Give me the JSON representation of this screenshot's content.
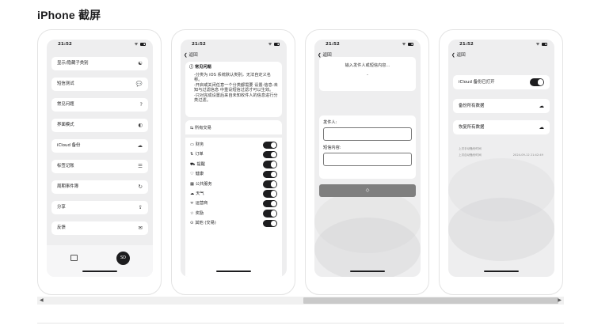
{
  "page_title": "iPhone 截屏",
  "status": {
    "time": "21:52",
    "signal": "•• ᯤ"
  },
  "back_label": "返回",
  "screen1": {
    "items": [
      {
        "label": "显示/隐藏子类别",
        "icon": "☯"
      },
      {
        "label": "短信测试",
        "icon": "💬"
      },
      {
        "label": "常见问题",
        "icon": "?"
      },
      {
        "label": "界面模式",
        "icon": "◐"
      },
      {
        "label": "iCloud 备份",
        "icon": "☁"
      },
      {
        "label": "标签记账",
        "icon": "☰"
      },
      {
        "label": "周期事件簿",
        "icon": "↻"
      },
      {
        "label": "分享",
        "icon": "⇪"
      },
      {
        "label": "反馈",
        "icon": "✉"
      }
    ],
    "tab_badge": "SD"
  },
  "screen2": {
    "faq_title": "常见问题",
    "faq_body": [
      "-分类为 iOS 系统默认类别，无法自定义名称。",
      "-开启或关闭任意一个分类都需要 设置-信息-未知与过滤信息 中重设短信过滤才可以生效。",
      "-只对完成设置后来自未知收件人的信息进行分类过滤。"
    ],
    "all_label": "所有交易",
    "categories": [
      {
        "icon": "▭",
        "label": "财务"
      },
      {
        "icon": "⇅",
        "label": "订单"
      },
      {
        "icon": "⛟",
        "label": "提醒"
      },
      {
        "icon": "♡",
        "label": "健康"
      },
      {
        "icon": "▦",
        "label": "公共服务"
      },
      {
        "icon": "☁",
        "label": "天气"
      },
      {
        "icon": "ᯤ",
        "label": "运营商"
      },
      {
        "icon": "☆",
        "label": "奖励"
      },
      {
        "icon": "⊙",
        "label": "其他 (交易)"
      }
    ]
  },
  "screen3": {
    "hint": "输入发件人或短信内容...",
    "dash": "-",
    "sender_label": "发件人:",
    "content_label": "短信内容:",
    "button_icon": "◇"
  },
  "screen4": {
    "toggle_label": "iCloud 备份已打开",
    "backup_label": "备份所有数据",
    "restore_label": "恢复所有数据",
    "meta1": "上次手动备份时间",
    "meta2": "上次自动备份时间",
    "meta2_value": "2024-09-12 21:42:49"
  }
}
